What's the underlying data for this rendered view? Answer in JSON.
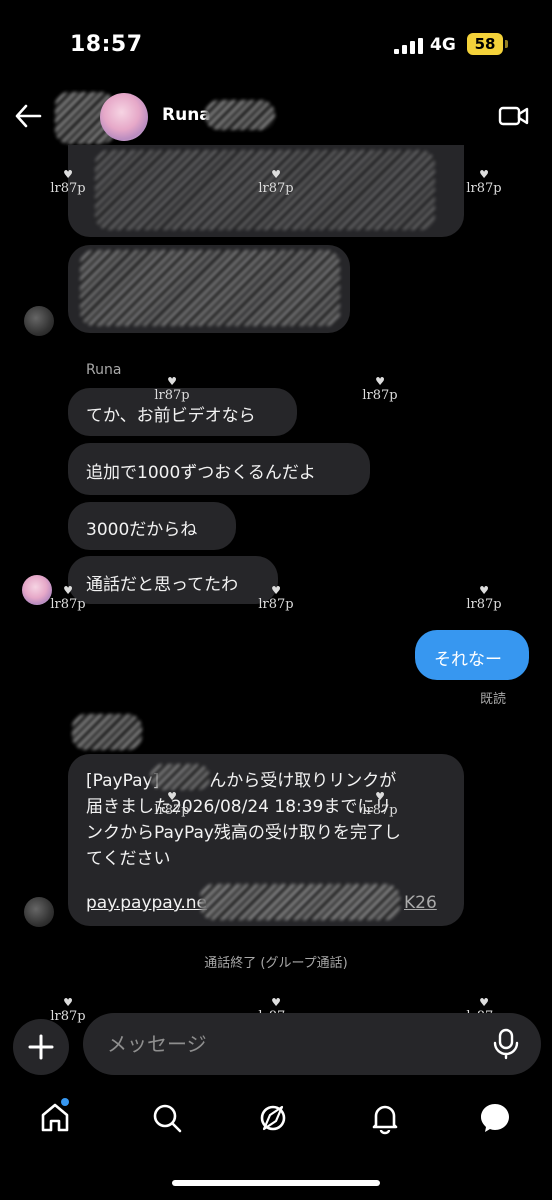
{
  "status_bar": {
    "time": "18:57",
    "network": "4G",
    "battery": "58"
  },
  "header": {
    "contact_name": "Runa"
  },
  "watermark": "lr87p",
  "messages": {
    "sender_label": "Runa",
    "m1": "てか、お前ビデオなら",
    "m2": "追加で1000ずつおくるんだよ",
    "m3": "3000だからね",
    "m4": "通話だと思ってたわ",
    "outgoing": "それなー",
    "read_receipt": "既読",
    "paypay_line1": "[PayPay]",
    "paypay_line1b": "んから受け取りリンクが",
    "paypay_line2": "届きました2026/08/24 18:39までにリ",
    "paypay_line3": "ンクからPayPay残高の受け取りを完了し",
    "paypay_line4": "てください",
    "paypay_link": "pay.paypay.ne",
    "paypay_link_tail": "K26",
    "call_ended": "通話終了 (グループ通話)"
  },
  "composer": {
    "placeholder": "メッセージ"
  },
  "icons": {
    "back": "back-arrow-icon",
    "video": "video-call-icon",
    "plus": "plus-icon",
    "mic": "microphone-icon",
    "home": "home-icon",
    "search": "search-icon",
    "explore": "explore-icon",
    "notifications": "bell-icon",
    "messages": "messages-icon"
  },
  "colors": {
    "accent": "#3797f0",
    "bubble_in": "#262629",
    "battery": "#f4d23a"
  }
}
